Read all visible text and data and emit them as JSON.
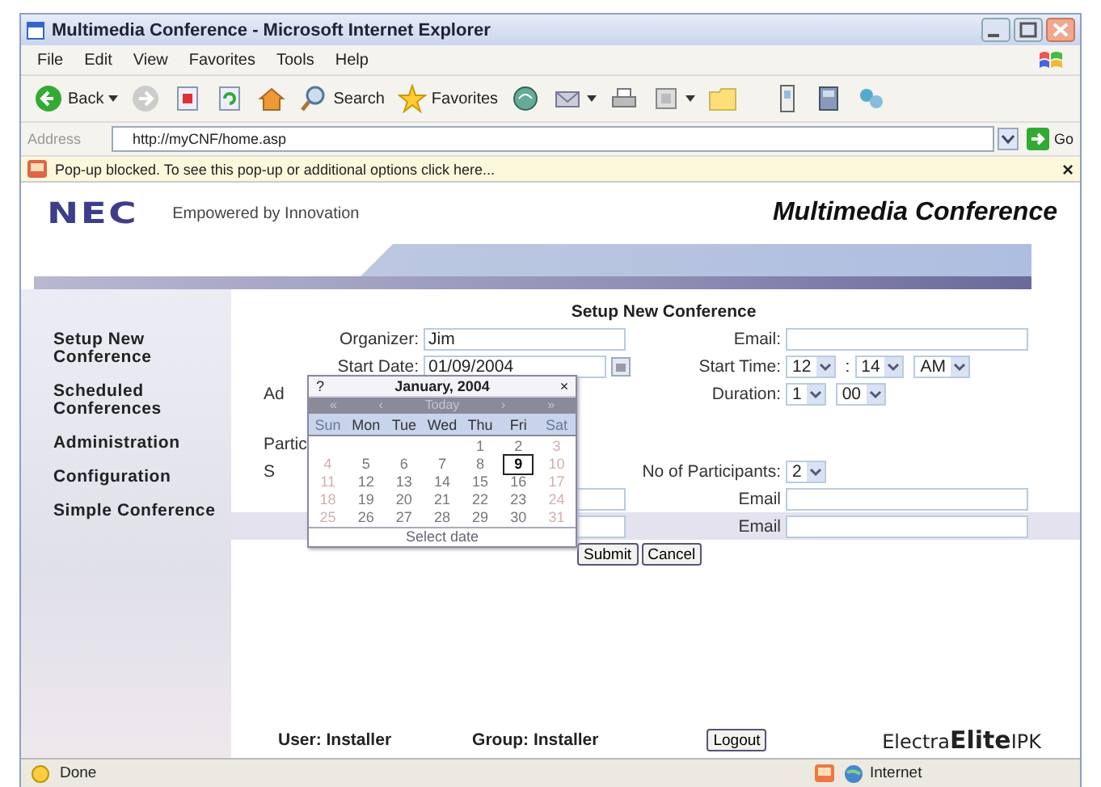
{
  "window": {
    "title": "Multimedia Conference - Microsoft Internet Explorer"
  },
  "menu": [
    "File",
    "Edit",
    "View",
    "Favorites",
    "Tools",
    "Help"
  ],
  "toolbar": [
    {
      "kind": "back",
      "label": "Back"
    },
    {
      "kind": "forward"
    },
    {
      "kind": "stop"
    },
    {
      "kind": "refresh"
    },
    {
      "kind": "home"
    },
    {
      "kind": "search",
      "label": "Search"
    },
    {
      "kind": "favorites",
      "label": "Favorites"
    },
    {
      "kind": "media"
    },
    {
      "kind": "mail"
    },
    {
      "kind": "print"
    },
    {
      "kind": "edit"
    },
    {
      "kind": "folder"
    },
    {
      "kind": "phone"
    },
    {
      "kind": "book"
    },
    {
      "kind": "tools"
    }
  ],
  "address": {
    "label": "Address",
    "value": "http://myCNF/home.asp",
    "go": "Go"
  },
  "infobar": {
    "text": "Pop-up blocked. To see this pop-up or additional options click here...",
    "close": "×"
  },
  "header": {
    "logo": "NEC",
    "tagline": "Empowered by Innovation",
    "title": "Multimedia Conference"
  },
  "sidebar": {
    "items": [
      "Setup New Conference",
      "Scheduled Conferences",
      "Administration",
      "Configuration",
      "Simple Conference"
    ]
  },
  "form": {
    "heading": "Setup New Conference",
    "rows": [
      {
        "left": {
          "kind": "text",
          "label": "Organizer:",
          "value": "Jim"
        },
        "right": {
          "kind": "text",
          "label": "Email:"
        }
      },
      {
        "left": {
          "kind": "date",
          "label": "Start Date:",
          "value": "01/09/2004"
        },
        "right": {
          "kind": "selects",
          "label": "Start Time:",
          "selects": [
            "12",
            "14",
            "AM"
          ],
          "separator": ":"
        }
      },
      {
        "left": {
          "kind": "covered",
          "label": "Ad"
        },
        "right": {
          "kind": "selects",
          "label": "Duration:",
          "selects": [
            "1",
            "00"
          ]
        }
      },
      {
        "left": {
          "kind": "covered",
          "label": "Partic"
        }
      },
      {
        "left": {
          "kind": "covered",
          "label": "S"
        },
        "right": {
          "kind": "selects",
          "label": "No of Participants:",
          "selects": [
            "2"
          ]
        }
      },
      {
        "left": {
          "kind": "text"
        },
        "right": {
          "kind": "text",
          "label": "Email"
        },
        "highlighted": false
      },
      {
        "left": {
          "kind": "text"
        },
        "right": {
          "kind": "text",
          "label": "Email"
        },
        "highlighted": true
      }
    ],
    "buttons": [
      "Submit",
      "Cancel"
    ]
  },
  "calendar": {
    "help": "?",
    "title": "January, 2004",
    "close": "×",
    "nav": [
      "«",
      "‹",
      "Today",
      "›",
      "»"
    ],
    "weekdays": [
      {
        "label": "Sun",
        "weekend": true
      },
      {
        "label": "Mon",
        "weekend": false
      },
      {
        "label": "Tue",
        "weekend": false
      },
      {
        "label": "Wed",
        "weekend": false
      },
      {
        "label": "Thu",
        "weekend": false
      },
      {
        "label": "Fri",
        "weekend": false
      },
      {
        "label": "Sat",
        "weekend": true
      }
    ],
    "weeks": [
      {
        "kind": "leading",
        "days": [
          {
            "day": "1",
            "weekend": false,
            "selected": false
          },
          {
            "day": "2",
            "weekend": false,
            "selected": false
          },
          {
            "day": "3",
            "weekend": true,
            "selected": false
          }
        ]
      },
      {
        "kind": "full",
        "days": [
          {
            "day": "4",
            "weekend": true,
            "selected": false
          },
          {
            "day": "5",
            "weekend": false,
            "selected": false
          },
          {
            "day": "6",
            "weekend": false,
            "selected": false
          },
          {
            "day": "7",
            "weekend": false,
            "selected": false
          },
          {
            "day": "8",
            "weekend": false,
            "selected": false
          },
          {
            "day": "9",
            "weekend": false,
            "selected": true
          },
          {
            "day": "10",
            "weekend": true,
            "selected": false
          }
        ]
      },
      {
        "kind": "full",
        "days": [
          {
            "day": "11",
            "weekend": true,
            "selected": false
          },
          {
            "day": "12",
            "weekend": false,
            "selected": false
          },
          {
            "day": "13",
            "weekend": false,
            "selected": false
          },
          {
            "day": "14",
            "weekend": false,
            "selected": false
          },
          {
            "day": "15",
            "weekend": false,
            "selected": false
          },
          {
            "day": "16",
            "weekend": false,
            "selected": false
          },
          {
            "day": "17",
            "weekend": true,
            "selected": false
          }
        ]
      },
      {
        "kind": "full",
        "days": [
          {
            "day": "18",
            "weekend": true,
            "selected": false
          },
          {
            "day": "19",
            "weekend": false,
            "selected": false
          },
          {
            "day": "20",
            "weekend": false,
            "selected": false
          },
          {
            "day": "21",
            "weekend": false,
            "selected": false
          },
          {
            "day": "22",
            "weekend": false,
            "selected": false
          },
          {
            "day": "23",
            "weekend": false,
            "selected": false
          },
          {
            "day": "24",
            "weekend": true,
            "selected": false
          }
        ]
      },
      {
        "kind": "full",
        "days": [
          {
            "day": "25",
            "weekend": true,
            "selected": false
          },
          {
            "day": "26",
            "weekend": false,
            "selected": false
          },
          {
            "day": "27",
            "weekend": false,
            "selected": false
          },
          {
            "day": "28",
            "weekend": false,
            "selected": false
          },
          {
            "day": "29",
            "weekend": false,
            "selected": false
          },
          {
            "day": "30",
            "weekend": false,
            "selected": false
          },
          {
            "day": "31",
            "weekend": true,
            "selected": false
          }
        ]
      }
    ],
    "footer": "Select date"
  },
  "footer": {
    "user": "User: Installer",
    "group": "Group: Installer",
    "logout": "Logout",
    "brand": "Electra**Elite**IPK"
  },
  "status_bar": {
    "text": "Done",
    "zone": "Internet"
  }
}
